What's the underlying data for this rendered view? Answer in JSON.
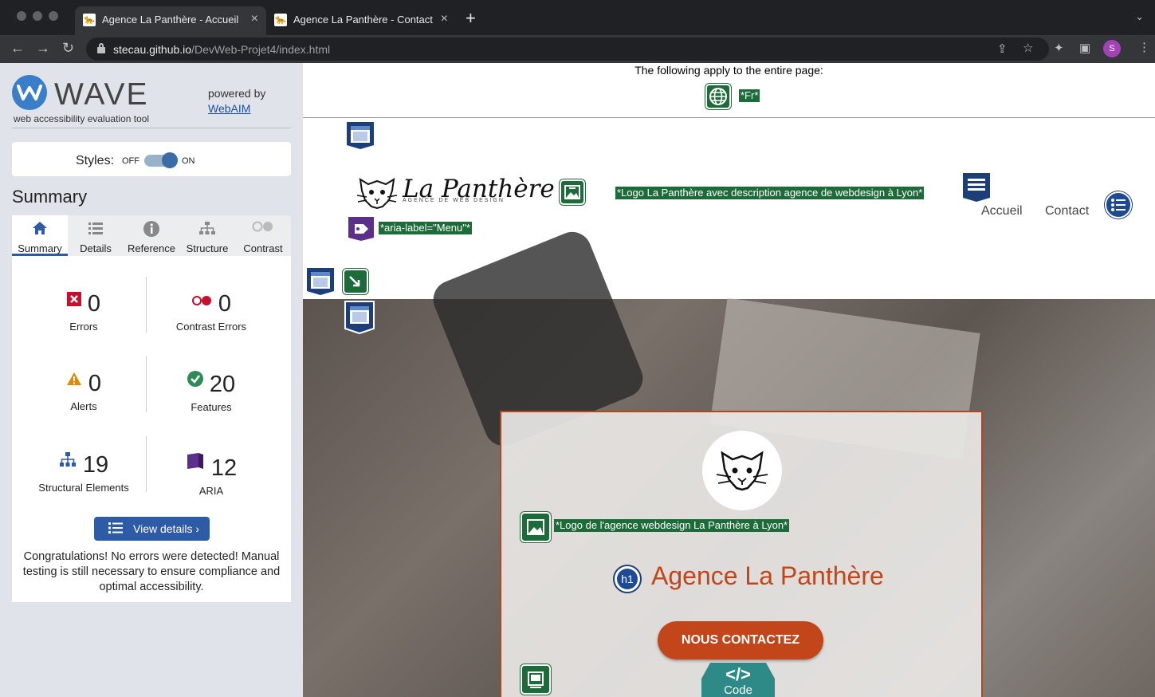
{
  "browser": {
    "tabs": [
      {
        "title": "Agence La Panthère - Accueil",
        "active": true
      },
      {
        "title": "Agence La Panthère - Contact",
        "active": false
      }
    ],
    "url_domain": "stecau.github.io",
    "url_path": "/DevWeb-Projet4/index.html",
    "profile_initial": "S"
  },
  "wave": {
    "name": "WAVE",
    "tagline": "web accessibility evaluation tool",
    "powered_by": "powered by",
    "webaim": "WebAIM",
    "styles_label": "Styles:",
    "styles_off": "OFF",
    "styles_on": "ON",
    "summary_heading": "Summary",
    "tabs": [
      "Summary",
      "Details",
      "Reference",
      "Structure",
      "Contrast"
    ],
    "stats": {
      "errors": {
        "value": "0",
        "label": "Errors"
      },
      "contrast_errors": {
        "value": "0",
        "label": "Contrast Errors"
      },
      "alerts": {
        "value": "0",
        "label": "Alerts"
      },
      "features": {
        "value": "20",
        "label": "Features"
      },
      "structural": {
        "value": "19",
        "label": "Structural Elements"
      },
      "aria": {
        "value": "12",
        "label": "ARIA"
      }
    },
    "view_details": "View details ›",
    "congrats": "Congratulations! No errors were detected! Manual testing is still necessary to ensure compliance and optimal accessibility."
  },
  "page": {
    "applies_text": "The following apply to the entire page:",
    "lang_label": "*Fr*",
    "logo_alt_label": "*Logo La Panthère avec description agence de webdesign à Lyon*",
    "aria_label": "*aria-label=\"Menu\"*",
    "brand": "La Panthère",
    "brand_sub": "AGENCE DE WEB DESIGN",
    "nav": [
      "Accueil",
      "Contact"
    ],
    "card_logo_alt_label": "*Logo de l'agence webdesign La Panthère à Lyon*",
    "h1_badge": "h1",
    "title": "Agence La Panthère",
    "cta": "NOUS CONTACTEZ",
    "code_icon_symbol": "</>",
    "code_icon_label": "Code"
  },
  "colors": {
    "wave_blue": "#2d5ba6",
    "feature_green": "#1e6b3a",
    "structure_navy": "#1c3f7a",
    "aria_purple": "#5b2f8a",
    "brand_orange": "#c2461a"
  }
}
